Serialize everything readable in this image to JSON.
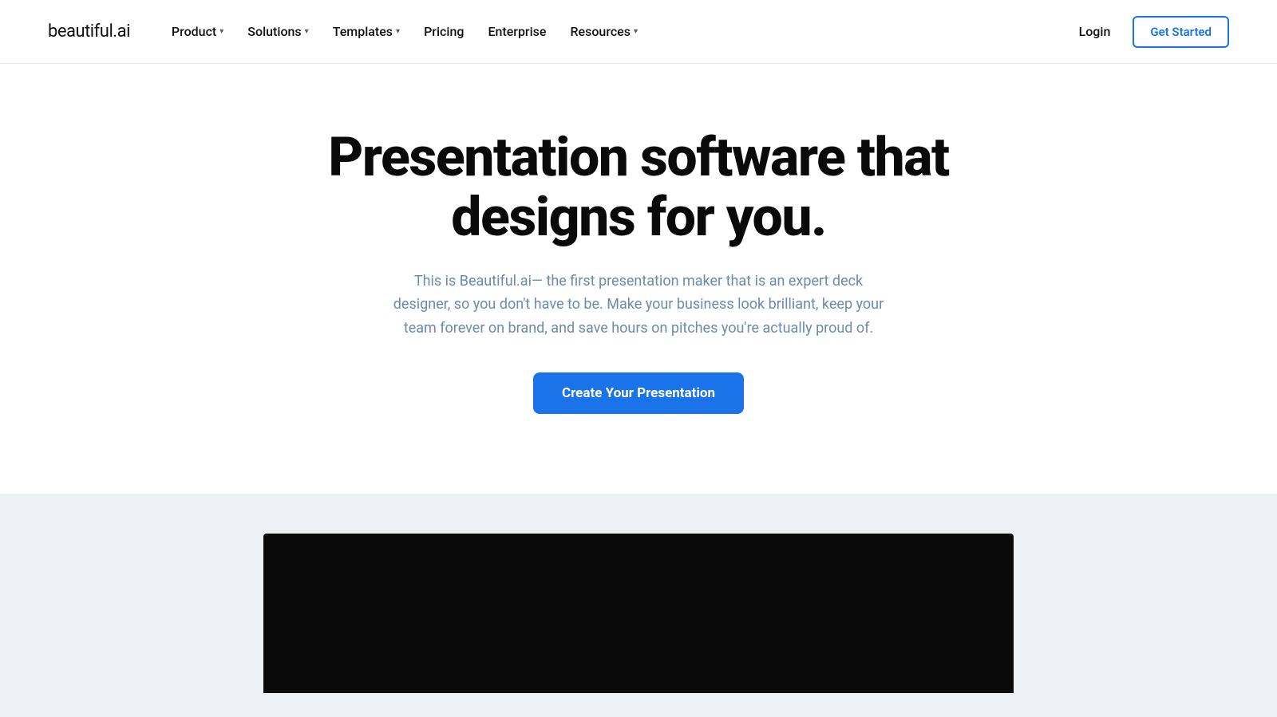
{
  "brand": {
    "name": "beautiful",
    "tld": ".ai"
  },
  "navbar": {
    "links": [
      {
        "label": "Product",
        "hasDropdown": true
      },
      {
        "label": "Solutions",
        "hasDropdown": true
      },
      {
        "label": "Templates",
        "hasDropdown": true
      },
      {
        "label": "Pricing",
        "hasDropdown": false
      },
      {
        "label": "Enterprise",
        "hasDropdown": false
      },
      {
        "label": "Resources",
        "hasDropdown": true
      }
    ],
    "login_label": "Login",
    "get_started_label": "Get Started"
  },
  "hero": {
    "title_line1": "Presentation software that",
    "title_line2": "designs for you.",
    "subtitle": "This is Beautiful.ai— the first presentation maker that is an expert deck designer, so you don't have to be. Make your business look brilliant, keep your team forever on brand, and save hours on pitches you're actually proud of.",
    "cta_label": "Create Your Presentation"
  }
}
